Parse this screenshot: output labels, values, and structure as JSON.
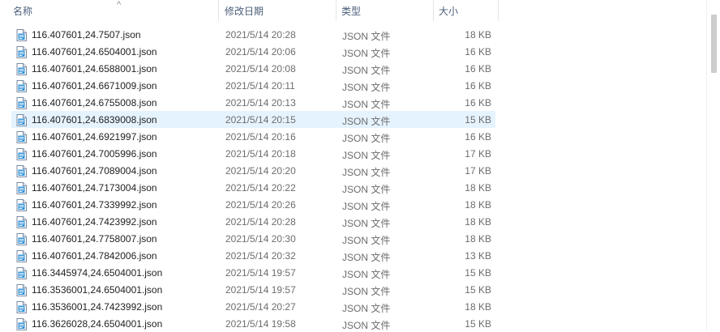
{
  "columns": {
    "name": "名称",
    "date": "修改日期",
    "type": "类型",
    "size": "大小"
  },
  "sort_indicator": "^",
  "files": [
    {
      "name": "116.407601,24.7507.json",
      "date": "2021/5/14 20:28",
      "type": "JSON 文件",
      "size": "18 KB"
    },
    {
      "name": "116.407601,24.6504001.json",
      "date": "2021/5/14 20:06",
      "type": "JSON 文件",
      "size": "16 KB"
    },
    {
      "name": "116.407601,24.6588001.json",
      "date": "2021/5/14 20:08",
      "type": "JSON 文件",
      "size": "16 KB"
    },
    {
      "name": "116.407601,24.6671009.json",
      "date": "2021/5/14 20:11",
      "type": "JSON 文件",
      "size": "16 KB"
    },
    {
      "name": "116.407601,24.6755008.json",
      "date": "2021/5/14 20:13",
      "type": "JSON 文件",
      "size": "16 KB"
    },
    {
      "name": "116.407601,24.6839008.json",
      "date": "2021/5/14 20:15",
      "type": "JSON 文件",
      "size": "15 KB",
      "selected": true
    },
    {
      "name": "116.407601,24.6921997.json",
      "date": "2021/5/14 20:16",
      "type": "JSON 文件",
      "size": "16 KB"
    },
    {
      "name": "116.407601,24.7005996.json",
      "date": "2021/5/14 20:18",
      "type": "JSON 文件",
      "size": "17 KB"
    },
    {
      "name": "116.407601,24.7089004.json",
      "date": "2021/5/14 20:20",
      "type": "JSON 文件",
      "size": "17 KB"
    },
    {
      "name": "116.407601,24.7173004.json",
      "date": "2021/5/14 20:22",
      "type": "JSON 文件",
      "size": "18 KB"
    },
    {
      "name": "116.407601,24.7339992.json",
      "date": "2021/5/14 20:26",
      "type": "JSON 文件",
      "size": "18 KB"
    },
    {
      "name": "116.407601,24.7423992.json",
      "date": "2021/5/14 20:28",
      "type": "JSON 文件",
      "size": "18 KB"
    },
    {
      "name": "116.407601,24.7758007.json",
      "date": "2021/5/14 20:30",
      "type": "JSON 文件",
      "size": "18 KB"
    },
    {
      "name": "116.407601,24.7842006.json",
      "date": "2021/5/14 20:32",
      "type": "JSON 文件",
      "size": "13 KB"
    },
    {
      "name": "116.3445974,24.6504001.json",
      "date": "2021/5/14 19:57",
      "type": "JSON 文件",
      "size": "15 KB"
    },
    {
      "name": "116.3536001,24.6504001.json",
      "date": "2021/5/14 19:57",
      "type": "JSON 文件",
      "size": "15 KB"
    },
    {
      "name": "116.3536001,24.7423992.json",
      "date": "2021/5/14 20:27",
      "type": "JSON 文件",
      "size": "18 KB"
    },
    {
      "name": "116.3626028,24.6504001.json",
      "date": "2021/5/14 19:58",
      "type": "JSON 文件",
      "size": "15 KB"
    }
  ],
  "icons": {
    "file": "json-file-icon"
  },
  "colors": {
    "selected_row": "#e5f3ff",
    "header_text": "#4c607a",
    "secondary_text": "#6d6d6d"
  }
}
